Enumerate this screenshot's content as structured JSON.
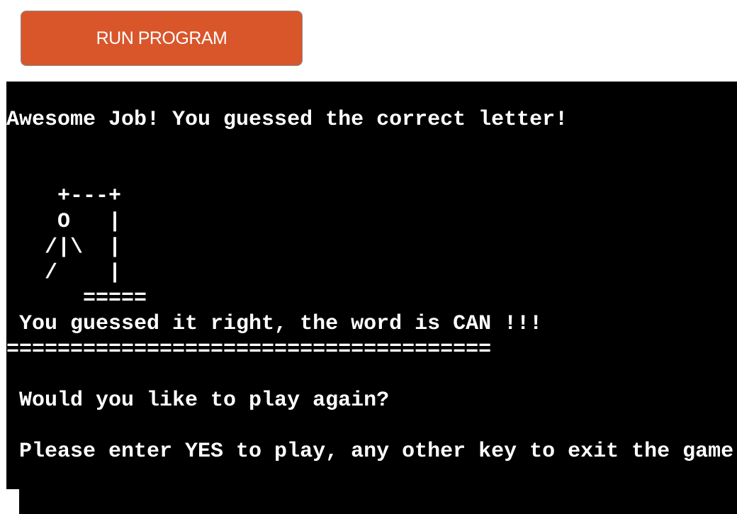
{
  "run_button": {
    "label": "RUN PROGRAM"
  },
  "terminal": {
    "lines": [
      "Awesome Job! You guessed the correct letter!",
      "",
      "",
      "    +---+",
      "    O   |",
      "   /|\\  |",
      "   /    |",
      "      =====",
      " You guessed it right, the word is CAN !!!",
      "======================================",
      "",
      " Would you like to play again?",
      "",
      " Please enter YES to play, any other key to exit the game"
    ]
  },
  "colors": {
    "button_bg": "#d9562b",
    "terminal_bg": "#000000",
    "text": "#ffffff"
  }
}
